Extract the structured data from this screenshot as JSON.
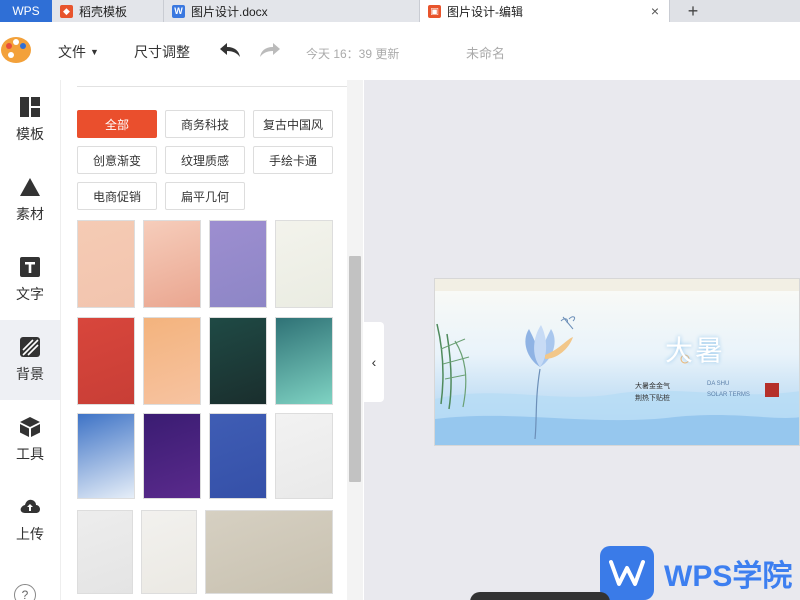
{
  "tabs": {
    "app": "WPS",
    "items": [
      {
        "label": "稻壳模板",
        "icon": "docer-icon",
        "color": "#e8542c"
      },
      {
        "label": "图片设计.docx",
        "icon": "word-icon",
        "color": "#3a78e0"
      },
      {
        "label": "图片设计-编辑",
        "icon": "picture-design-icon",
        "color": "#e8542c"
      }
    ],
    "close": "×",
    "add": "+"
  },
  "toolbar": {
    "file_label": "文件",
    "size_label": "尺寸调整",
    "saved_status": "今天 16：39 更新",
    "doc_title": "未命名"
  },
  "leftnav": {
    "items": [
      {
        "label": "模板",
        "icon": "template-icon"
      },
      {
        "label": "素材",
        "icon": "material-icon"
      },
      {
        "label": "文字",
        "icon": "text-icon"
      },
      {
        "label": "背景",
        "icon": "background-icon"
      },
      {
        "label": "工具",
        "icon": "tool-icon"
      },
      {
        "label": "上传",
        "icon": "upload-icon"
      }
    ],
    "active": "背景",
    "help": "?"
  },
  "panel": {
    "categories": [
      "全部",
      "商务科技",
      "复古中国风",
      "创意渐变",
      "纹理质感",
      "手绘卡通",
      "电商促销",
      "扁平几何"
    ],
    "active_category": "全部",
    "accent": "#ea4f2d",
    "thumbnails": [
      {
        "colors": [
          "#f5cbb4",
          "#f2c4ae"
        ]
      },
      {
        "colors": [
          "#f6cdbb",
          "#eaa690"
        ]
      },
      {
        "colors": [
          "#9d8ed0",
          "#8d86c6"
        ]
      },
      {
        "colors": [
          "#f3f3ec",
          "#eaece2"
        ]
      },
      {
        "colors": [
          "#d8463c",
          "#c83e36"
        ]
      },
      {
        "colors": [
          "#f3b37d",
          "#f7c3a1"
        ]
      },
      {
        "colors": [
          "#1f4a45",
          "#1a2e2d"
        ]
      },
      {
        "colors": [
          "#2f7276",
          "#7fd3c3"
        ]
      },
      {
        "colors": [
          "#3e73c6",
          "#e6eef8"
        ]
      },
      {
        "colors": [
          "#3a1c72",
          "#5a2a8c"
        ]
      },
      {
        "colors": [
          "#3f5db4",
          "#3550a8"
        ]
      },
      {
        "colors": [
          "#f2f2f2",
          "#e9e9e9"
        ]
      },
      {
        "colors": [
          "#ededed",
          "#e4e4e4"
        ]
      },
      {
        "colors": [
          "#f2f1ee",
          "#ebe9e3"
        ]
      },
      {
        "colors": [
          "#d6d0c2",
          "#c8c1b0"
        ]
      }
    ]
  },
  "banner": {
    "title": "大暑",
    "line1": "大暑金金气",
    "line2": "荆热下贴桩",
    "en1": "DA SHU",
    "en2": "SOLAR TERMS"
  },
  "watermark": {
    "text": "WPS学院"
  }
}
